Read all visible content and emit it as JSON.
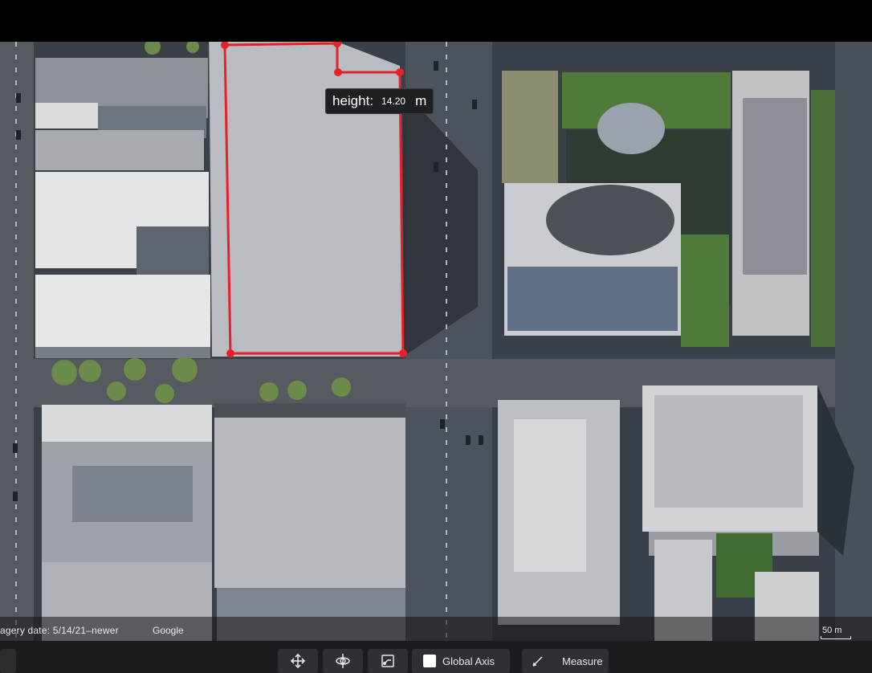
{
  "measurement": {
    "label": "height:",
    "value": "14.20",
    "unit": "m"
  },
  "attribution": {
    "imagery_date": "agery date: 5/14/21–newer",
    "provider": "Google",
    "scale": "50 m"
  },
  "toolbar": {
    "move_icon": "move-icon",
    "rotate_icon": "rotate-icon",
    "snap_icon": "snap-icon",
    "global_axis_label": "Global Axis",
    "global_axis_checked": true,
    "measure_label": "Measure",
    "measure_icon": "pencil-icon"
  },
  "colors": {
    "measure_line": "#e8202a",
    "extruded_block": "#b9bcc0",
    "toolbar_bg": "#1b1c20"
  }
}
